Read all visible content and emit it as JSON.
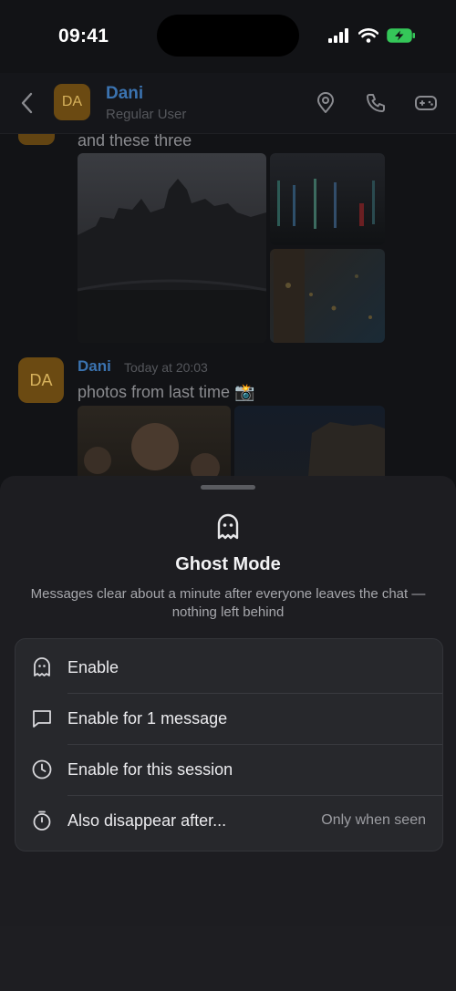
{
  "status": {
    "time": "09:41"
  },
  "header": {
    "avatar_initials": "DA",
    "name": "Dani",
    "subtitle": "Regular User"
  },
  "messages": {
    "first_text": "and these three",
    "second": {
      "avatar_initials": "DA",
      "sender": "Dani",
      "time": "Today at 20:03",
      "text": "photos from last time 📸"
    }
  },
  "sheet": {
    "title": "Ghost Mode",
    "description": "Messages clear about a minute after everyone leaves the chat — nothing left behind",
    "options": [
      {
        "label": "Enable",
        "icon": "ghost-icon"
      },
      {
        "label": "Enable for 1 message",
        "icon": "message-icon"
      },
      {
        "label": "Enable for this session",
        "icon": "clock-icon"
      },
      {
        "label": "Also disappear after...",
        "icon": "timer-icon",
        "value": "Only when seen"
      }
    ]
  }
}
